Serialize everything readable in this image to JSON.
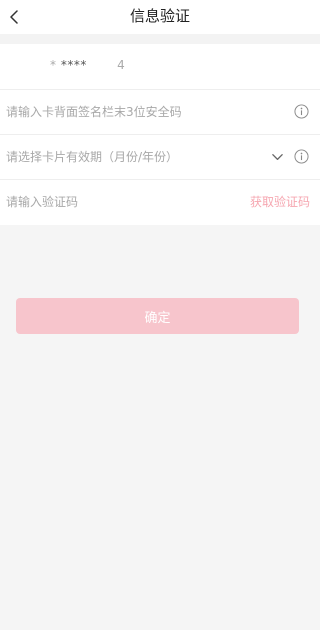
{
  "header": {
    "title": "信息验证"
  },
  "card": {
    "number_masked": "****",
    "prefix": "*",
    "suffix": "4"
  },
  "form": {
    "cvv_placeholder": "请输入卡背面签名栏末3位安全码",
    "expiry_placeholder": "请选择卡片有效期（月份/年份）",
    "code_placeholder": "请输入验证码",
    "get_code_label": "获取验证码"
  },
  "actions": {
    "confirm_label": "确定"
  },
  "colors": {
    "accent": "#f6a6b0",
    "button_disabled": "#f7c5cc",
    "background": "#f5f5f5"
  },
  "icons": {
    "back": "chevron-left-icon",
    "info": "info-circle-icon",
    "dropdown": "chevron-down-icon"
  }
}
